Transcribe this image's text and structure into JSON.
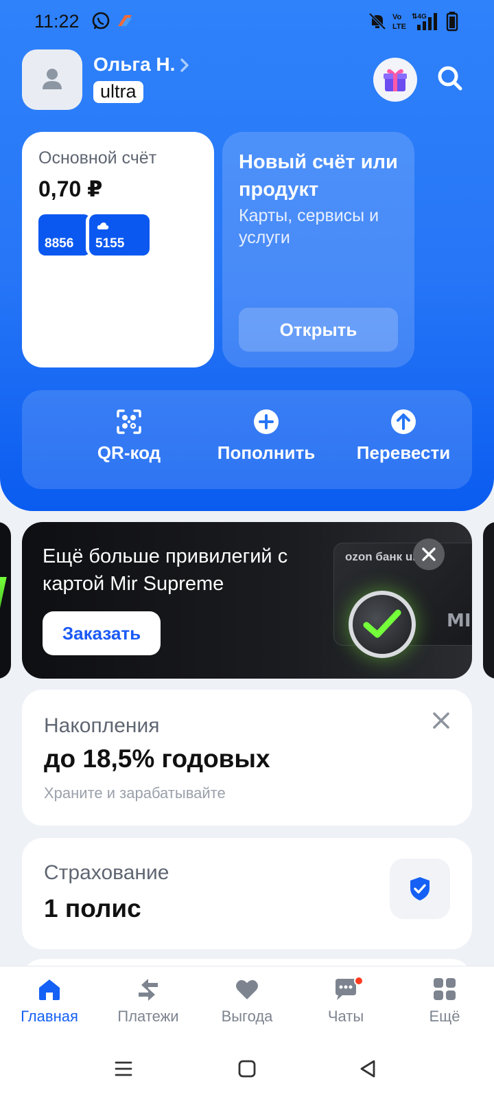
{
  "status_bar": {
    "time": "11:22"
  },
  "profile": {
    "name": "Ольга Н.",
    "tier": "ultra"
  },
  "account_card": {
    "title": "Основной счёт",
    "balance": "0,70 ₽",
    "cards": [
      {
        "last_digits": "8856"
      },
      {
        "last_digits": "5155",
        "icon": "cloud-icon"
      }
    ]
  },
  "new_product_card": {
    "title": "Новый счёт или продукт",
    "subtitle": "Карты, сервисы и услуги",
    "button_label": "Открыть"
  },
  "actions": [
    {
      "label": "QR-код",
      "icon": "qr-scan-icon"
    },
    {
      "label": "Пополнить",
      "icon": "plus-circle-icon"
    },
    {
      "label": "Перевести",
      "icon": "arrow-up-circle-icon"
    }
  ],
  "promo_banner": {
    "text": "Ещё больше привилегий с картой Mir Supreme",
    "button_label": "Заказать",
    "card_label": "ozon банк ultra",
    "card_brand": "MIR"
  },
  "savings": {
    "title": "Накопления",
    "rate": "до 18,5% годовых",
    "subtitle": "Храните и зарабатывайте"
  },
  "insurance": {
    "title": "Страхование",
    "count": "1 полис",
    "icon": "shield-check-icon"
  },
  "bottom_nav": [
    {
      "label": "Главная",
      "icon": "home-icon",
      "active": true
    },
    {
      "label": "Платежи",
      "icon": "transfer-arrows-icon",
      "active": false
    },
    {
      "label": "Выгода",
      "icon": "heart-icon",
      "active": false
    },
    {
      "label": "Чаты",
      "icon": "chat-icon",
      "active": false,
      "badge": true
    },
    {
      "label": "Ещё",
      "icon": "grid-icon",
      "active": false
    }
  ],
  "colors": {
    "brand_blue": "#2675f7",
    "accent_blue": "#1560f5",
    "badge_red": "#ff3b1f",
    "promo_check_green": "#74ff3a"
  }
}
